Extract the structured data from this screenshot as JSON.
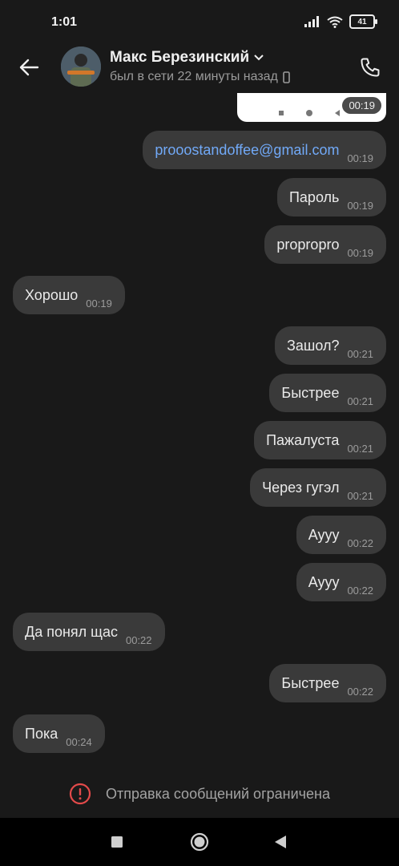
{
  "status_bar": {
    "time": "1:01",
    "battery": "41"
  },
  "contact": {
    "name": "Макс Березинский",
    "status": "был в сети 22 минуты назад"
  },
  "image_message": {
    "time": "00:19"
  },
  "messages": [
    {
      "dir": "out",
      "text": "prooostandoffee@gmail.com",
      "time": "00:19"
    },
    {
      "dir": "out",
      "text": "Пароль",
      "time": "00:19"
    },
    {
      "dir": "out",
      "text": "proproprо",
      "time": "00:19"
    },
    {
      "dir": "in",
      "text": "Хорошо",
      "time": "00:19"
    },
    {
      "dir": "out",
      "text": "Зашол?",
      "time": "00:21"
    },
    {
      "dir": "out",
      "text": "Быстрее",
      "time": "00:21"
    },
    {
      "dir": "out",
      "text": "Пажалуста",
      "time": "00:21"
    },
    {
      "dir": "out",
      "text": "Через гугэл",
      "time": "00:21"
    },
    {
      "dir": "out",
      "text": "Ayyy",
      "time": "00:22"
    },
    {
      "dir": "out",
      "text": "Ayyy",
      "time": "00:22"
    },
    {
      "dir": "in",
      "text": "Да понял щас",
      "time": "00:22"
    },
    {
      "dir": "out",
      "text": "Быстрее",
      "time": "00:22"
    },
    {
      "dir": "in",
      "text": "Пока",
      "time": "00:24"
    }
  ],
  "restriction": {
    "text": "Отправка сообщений ограничена"
  },
  "colors": {
    "background": "#191919",
    "bubble": "#3a3a3a",
    "link": "#71a9f7",
    "alert": "#e34a4a"
  }
}
